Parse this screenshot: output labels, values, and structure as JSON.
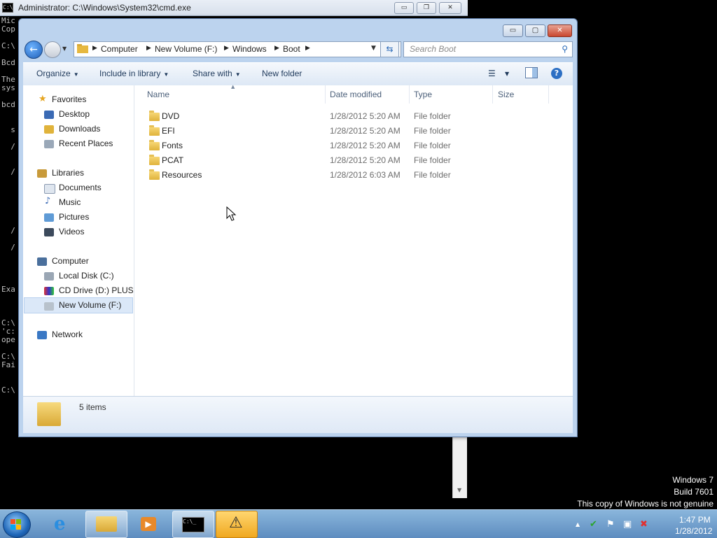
{
  "cmd": {
    "title": "Administrator: C:\\Windows\\System32\\cmd.exe",
    "icon_text": "C:\\",
    "lines": [
      "Mic",
      "Cop",
      "",
      "C:\\",
      "",
      "Bcd",
      "",
      "The",
      "sys",
      "",
      "bcd",
      "",
      "",
      "  s",
      "",
      "  /",
      "",
      "",
      "  /",
      "",
      "",
      "",
      "",
      "",
      "",
      "  /",
      "",
      "  /",
      "",
      "",
      "",
      "",
      "Exa",
      "",
      "",
      "",
      "C:\\",
      "'c:",
      "ope",
      "",
      "C:\\",
      "Fai",
      "",
      "",
      "C:\\"
    ],
    "minimize": "▭",
    "restore": "❐",
    "close": "✕"
  },
  "explorer": {
    "minimize": "▭",
    "maximize": "▢",
    "close": "✕",
    "breadcrumb": [
      "Computer",
      "New Volume (F:)",
      "Windows",
      "Boot"
    ],
    "search_placeholder": "Search Boot",
    "toolbar": {
      "organize": "Organize",
      "include_in_library": "Include in library",
      "share_with": "Share with",
      "new_folder": "New folder"
    },
    "nav": {
      "favorites": "Favorites",
      "desktop": "Desktop",
      "downloads": "Downloads",
      "recent_places": "Recent Places",
      "libraries": "Libraries",
      "documents": "Documents",
      "music": "Music",
      "pictures": "Pictures",
      "videos": "Videos",
      "computer": "Computer",
      "local_disk": "Local Disk (C:)",
      "cd_drive": "CD Drive (D:) PLUS9",
      "new_volume": "New Volume (F:)",
      "network": "Network"
    },
    "columns": {
      "name": "Name",
      "date_modified": "Date modified",
      "type": "Type",
      "size": "Size"
    },
    "files": [
      {
        "name": "DVD",
        "date": "1/28/2012 5:20 AM",
        "type": "File folder"
      },
      {
        "name": "EFI",
        "date": "1/28/2012 5:20 AM",
        "type": "File folder"
      },
      {
        "name": "Fonts",
        "date": "1/28/2012 5:20 AM",
        "type": "File folder"
      },
      {
        "name": "PCAT",
        "date": "1/28/2012 5:20 AM",
        "type": "File folder"
      },
      {
        "name": "Resources",
        "date": "1/28/2012 6:03 AM",
        "type": "File folder"
      }
    ],
    "status": "5 items"
  },
  "watermark": {
    "line1": "Windows 7",
    "line2": "Build 7601",
    "line3": "This copy of Windows is not genuine"
  },
  "taskbar": {
    "time": "1:47 PM",
    "date": "1/28/2012",
    "cmd_icon_text": "C:\\_"
  },
  "colors": {
    "accent": "#2c6fc4",
    "window_frame": "#bcd3ee",
    "folder": "#e0b33b"
  }
}
